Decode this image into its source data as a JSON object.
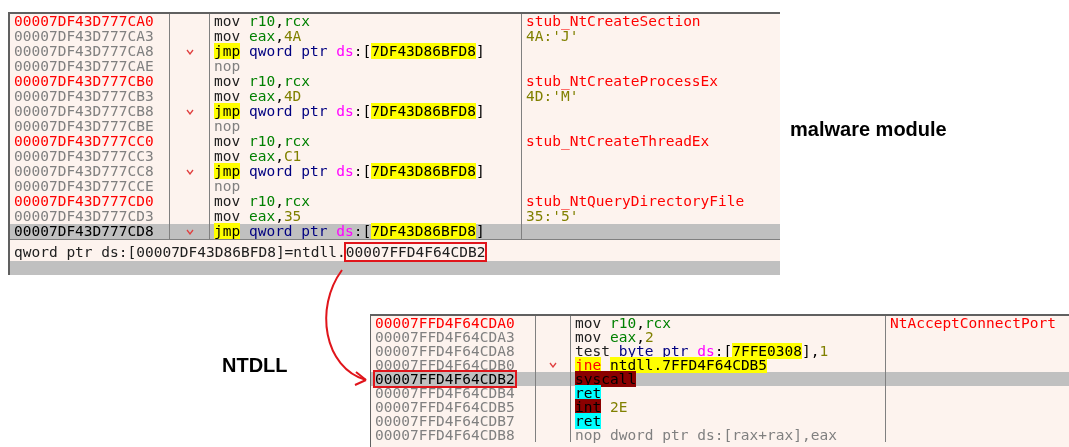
{
  "malware_panel": {
    "rows": [
      {
        "address": "00007DF43D777CA0",
        "entry": true,
        "selected": false,
        "boxed": false,
        "branch": false,
        "ins": [
          {
            "text": "mov",
            "kind": "mnemonic"
          },
          {
            "text": " r10",
            "kind": "reg"
          },
          {
            "text": ",",
            "kind": "punct"
          },
          {
            "text": "rcx",
            "kind": "reg"
          }
        ],
        "comment": {
          "text": "stub_NtCreateSection",
          "kind": "label"
        }
      },
      {
        "address": "00007DF43D777CA3",
        "entry": false,
        "selected": false,
        "boxed": false,
        "branch": false,
        "ins": [
          {
            "text": "mov",
            "kind": "mnemonic"
          },
          {
            "text": " eax",
            "kind": "reg"
          },
          {
            "text": ",",
            "kind": "punct"
          },
          {
            "text": "4A",
            "kind": "num"
          }
        ],
        "comment": {
          "text": "4A:'J'",
          "kind": "char"
        }
      },
      {
        "address": "00007DF43D777CA8",
        "entry": false,
        "selected": false,
        "boxed": false,
        "branch": true,
        "ins": [
          {
            "text": "jmp",
            "kind": "jump"
          },
          {
            "text": " qword ptr ",
            "kind": "ptr"
          },
          {
            "text": "ds",
            "kind": "seg"
          },
          {
            "text": ":[",
            "kind": "punct"
          },
          {
            "text": "7DF43D86BFD8",
            "kind": "addr"
          },
          {
            "text": "]",
            "kind": "punct"
          }
        ]
      },
      {
        "address": "00007DF43D777CAE",
        "entry": false,
        "selected": false,
        "boxed": false,
        "branch": false,
        "ins": [
          {
            "text": "nop",
            "kind": "nop"
          }
        ]
      },
      {
        "address": "00007DF43D777CB0",
        "entry": true,
        "selected": false,
        "boxed": false,
        "branch": false,
        "ins": [
          {
            "text": "mov",
            "kind": "mnemonic"
          },
          {
            "text": " r10",
            "kind": "reg"
          },
          {
            "text": ",",
            "kind": "punct"
          },
          {
            "text": "rcx",
            "kind": "reg"
          }
        ],
        "comment": {
          "text": "stub_NtCreateProcessEx",
          "kind": "label"
        }
      },
      {
        "address": "00007DF43D777CB3",
        "entry": false,
        "selected": false,
        "boxed": false,
        "branch": false,
        "ins": [
          {
            "text": "mov",
            "kind": "mnemonic"
          },
          {
            "text": " eax",
            "kind": "reg"
          },
          {
            "text": ",",
            "kind": "punct"
          },
          {
            "text": "4D",
            "kind": "num"
          }
        ],
        "comment": {
          "text": "4D:'M'",
          "kind": "char"
        }
      },
      {
        "address": "00007DF43D777CB8",
        "entry": false,
        "selected": false,
        "boxed": false,
        "branch": true,
        "ins": [
          {
            "text": "jmp",
            "kind": "jump"
          },
          {
            "text": " qword ptr ",
            "kind": "ptr"
          },
          {
            "text": "ds",
            "kind": "seg"
          },
          {
            "text": ":[",
            "kind": "punct"
          },
          {
            "text": "7DF43D86BFD8",
            "kind": "addr"
          },
          {
            "text": "]",
            "kind": "punct"
          }
        ]
      },
      {
        "address": "00007DF43D777CBE",
        "entry": false,
        "selected": false,
        "boxed": false,
        "branch": false,
        "ins": [
          {
            "text": "nop",
            "kind": "nop"
          }
        ]
      },
      {
        "address": "00007DF43D777CC0",
        "entry": true,
        "selected": false,
        "boxed": false,
        "branch": false,
        "ins": [
          {
            "text": "mov",
            "kind": "mnemonic"
          },
          {
            "text": " r10",
            "kind": "reg"
          },
          {
            "text": ",",
            "kind": "punct"
          },
          {
            "text": "rcx",
            "kind": "reg"
          }
        ],
        "comment": {
          "text": "stub_NtCreateThreadEx",
          "kind": "label"
        }
      },
      {
        "address": "00007DF43D777CC3",
        "entry": false,
        "selected": false,
        "boxed": false,
        "branch": false,
        "ins": [
          {
            "text": "mov",
            "kind": "mnemonic"
          },
          {
            "text": " eax",
            "kind": "reg"
          },
          {
            "text": ",",
            "kind": "punct"
          },
          {
            "text": "C1",
            "kind": "num"
          }
        ]
      },
      {
        "address": "00007DF43D777CC8",
        "entry": false,
        "selected": false,
        "boxed": false,
        "branch": true,
        "ins": [
          {
            "text": "jmp",
            "kind": "jump"
          },
          {
            "text": " qword ptr ",
            "kind": "ptr"
          },
          {
            "text": "ds",
            "kind": "seg"
          },
          {
            "text": ":[",
            "kind": "punct"
          },
          {
            "text": "7DF43D86BFD8",
            "kind": "addr"
          },
          {
            "text": "]",
            "kind": "punct"
          }
        ]
      },
      {
        "address": "00007DF43D777CCE",
        "entry": false,
        "selected": false,
        "boxed": false,
        "branch": false,
        "ins": [
          {
            "text": "nop",
            "kind": "nop"
          }
        ]
      },
      {
        "address": "00007DF43D777CD0",
        "entry": true,
        "selected": false,
        "boxed": false,
        "branch": false,
        "ins": [
          {
            "text": "mov",
            "kind": "mnemonic"
          },
          {
            "text": " r10",
            "kind": "reg"
          },
          {
            "text": ",",
            "kind": "punct"
          },
          {
            "text": "rcx",
            "kind": "reg"
          }
        ],
        "comment": {
          "text": "stub_NtQueryDirectoryFile",
          "kind": "label"
        }
      },
      {
        "address": "00007DF43D777CD3",
        "entry": false,
        "selected": false,
        "boxed": false,
        "branch": false,
        "ins": [
          {
            "text": "mov",
            "kind": "mnemonic"
          },
          {
            "text": " eax",
            "kind": "reg"
          },
          {
            "text": ",",
            "kind": "punct"
          },
          {
            "text": "35",
            "kind": "num"
          }
        ],
        "comment": {
          "text": "35:'5'",
          "kind": "char"
        }
      },
      {
        "address": "00007DF43D777CD8",
        "entry": false,
        "selected": true,
        "boxed": false,
        "branch": true,
        "ins": [
          {
            "text": "jmp",
            "kind": "jump"
          },
          {
            "text": " qword ptr ",
            "kind": "ptr"
          },
          {
            "text": "ds",
            "kind": "seg"
          },
          {
            "text": ":[",
            "kind": "punct"
          },
          {
            "text": "7DF43D86BFD8",
            "kind": "addr"
          },
          {
            "text": "]",
            "kind": "punct"
          }
        ]
      }
    ],
    "status": {
      "text": "qword ptr ds:[00007DF43D86BFD8]=ntdll.",
      "target": "00007FFD4F64CDB2"
    }
  },
  "captions": [
    {
      "text": "malware module",
      "kind": "malware"
    },
    {
      "text": "NTDLL",
      "kind": "ntdll"
    }
  ],
  "ntdll_panel": {
    "rows": [
      {
        "address": "00007FFD4F64CDA0",
        "entry": true,
        "selected": false,
        "boxed": false,
        "branch": false,
        "ins": [
          {
            "text": "mov",
            "kind": "mnemonic"
          },
          {
            "text": " r10",
            "kind": "reg"
          },
          {
            "text": ",",
            "kind": "punct"
          },
          {
            "text": "rcx",
            "kind": "reg"
          }
        ],
        "comment": {
          "text": "NtAcceptConnectPort",
          "kind": "label"
        }
      },
      {
        "address": "00007FFD4F64CDA3",
        "entry": false,
        "selected": false,
        "boxed": false,
        "branch": false,
        "ins": [
          {
            "text": "mov",
            "kind": "mnemonic"
          },
          {
            "text": " eax",
            "kind": "reg"
          },
          {
            "text": ",",
            "kind": "punct"
          },
          {
            "text": "2",
            "kind": "num"
          }
        ]
      },
      {
        "address": "00007FFD4F64CDA8",
        "entry": false,
        "selected": false,
        "boxed": false,
        "branch": false,
        "ins": [
          {
            "text": "test",
            "kind": "mnemonic"
          },
          {
            "text": " byte ptr ",
            "kind": "ptr"
          },
          {
            "text": "ds",
            "kind": "seg"
          },
          {
            "text": ":[",
            "kind": "punct"
          },
          {
            "text": "7FFE0308",
            "kind": "addr"
          },
          {
            "text": "],",
            "kind": "punct"
          },
          {
            "text": "1",
            "kind": "num"
          }
        ]
      },
      {
        "address": "00007FFD4F64CDB0",
        "entry": false,
        "selected": false,
        "boxed": false,
        "branch": true,
        "ins": [
          {
            "text": "jne",
            "kind": "cond_jump"
          },
          {
            "text": " ntdll.7FFD4F64CDB5",
            "kind": "addr"
          }
        ]
      },
      {
        "address": "00007FFD4F64CDB2",
        "entry": false,
        "selected": true,
        "boxed": true,
        "branch": false,
        "ins": [
          {
            "text": "syscall",
            "kind": "trap"
          }
        ]
      },
      {
        "address": "00007FFD4F64CDB4",
        "entry": false,
        "selected": false,
        "boxed": false,
        "branch": false,
        "ins": [
          {
            "text": "ret",
            "kind": "ret"
          }
        ]
      },
      {
        "address": "00007FFD4F64CDB5",
        "entry": false,
        "selected": false,
        "boxed": false,
        "branch": false,
        "ins": [
          {
            "text": "int",
            "kind": "trap"
          },
          {
            "text": " 2E",
            "kind": "num"
          }
        ]
      },
      {
        "address": "00007FFD4F64CDB7",
        "entry": false,
        "selected": false,
        "boxed": false,
        "branch": false,
        "ins": [
          {
            "text": "ret",
            "kind": "ret"
          }
        ]
      },
      {
        "address": "00007FFD4F64CDB8",
        "entry": false,
        "selected": false,
        "boxed": false,
        "branch": false,
        "ins": [
          {
            "text": "nop dword ptr ds:[rax+rax],eax",
            "kind": "nop"
          }
        ]
      }
    ]
  }
}
